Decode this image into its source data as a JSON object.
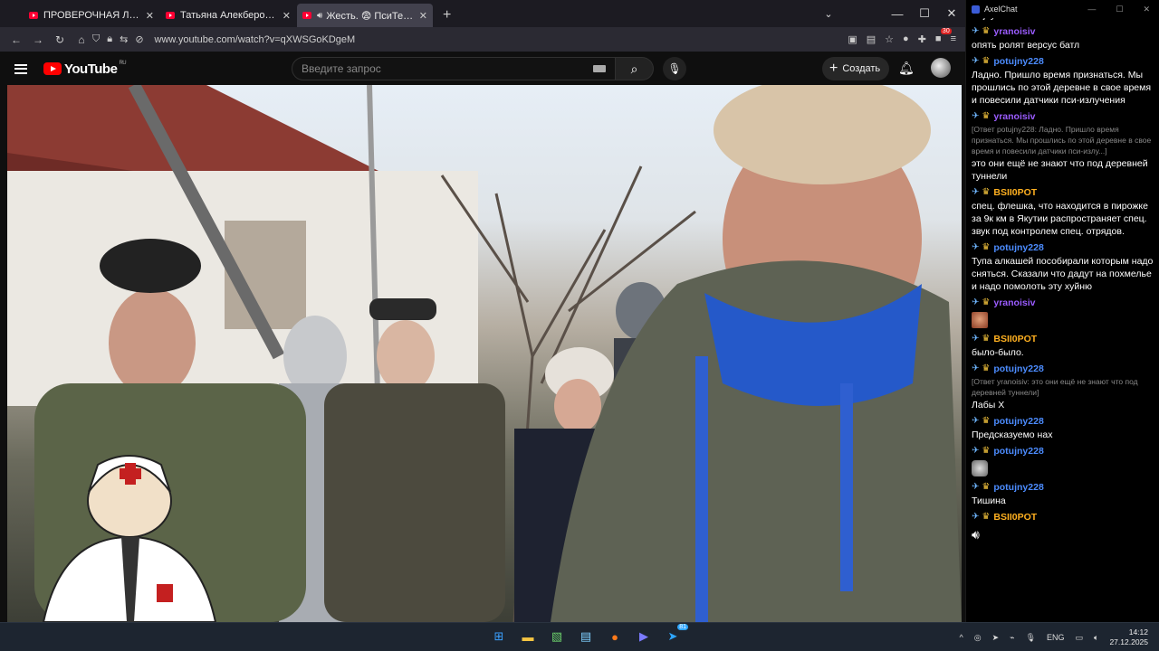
{
  "browser": {
    "tabs": [
      {
        "title": "ПРОВЕРОЧНАЯ ЛИНЕЙКА - М",
        "active": false,
        "audio": false
      },
      {
        "title": "Татьяна Алекберова - YouTube",
        "active": false,
        "audio": false
      },
      {
        "title": "Жесть. 😨 ПсиТеррор Сел",
        "active": true,
        "audio": true
      }
    ],
    "url": "www.youtube.com/watch?v=qXWSGoKDgeM",
    "extension_badge": "30"
  },
  "youtube": {
    "logo": "YouTube",
    "region": "RU",
    "search_placeholder": "Введите запрос",
    "create_label": "Создать"
  },
  "chat": {
    "app_title": "AxelChat",
    "top_partial": "Enjoyer",
    "messages": [
      {
        "user": "yranoisiv",
        "color": "#9b5cff",
        "text": "опять ролят версус батл"
      },
      {
        "user": "potujny228",
        "color": "#4c8cff",
        "text": "Ладно. Пришло время признаться. Мы прошлись по этой деревне в свое время и повесили датчики пси-излучения"
      },
      {
        "user": "yranoisiv",
        "color": "#9b5cff",
        "quote": "[Ответ potujny228: Ладно. Пришло время признаться. Мы прошлись по этой деревне в свое время и повесили датчики пси-излу...]",
        "text": "это они ещё не знают что под деревней туннели"
      },
      {
        "user": "BSII0POT",
        "color": "#ffb020",
        "text": "спец. флешка, что находится в пирожке за 9к км в Якутии распространяет спец. звук под контролем спец. отрядов."
      },
      {
        "user": "potujny228",
        "color": "#4c8cff",
        "text": "Тупа алкашей пособирали которым надо сняться. Сказали что дадут на похмелье и надо помолоть эту хуйню"
      },
      {
        "user": "yranoisiv",
        "color": "#9b5cff",
        "emote": "face"
      },
      {
        "user": "BSII0POT",
        "color": "#ffb020",
        "text": "было-было."
      },
      {
        "user": "potujny228",
        "color": "#4c8cff",
        "quote": "[Ответ yranoisiv: это они ещё не знают что под деревней туннели]",
        "text": "Лабы Х"
      },
      {
        "user": "potujny228",
        "color": "#4c8cff",
        "text": "Предсказуемо нах"
      },
      {
        "user": "potujny228",
        "color": "#4c8cff",
        "emote": "cat"
      },
      {
        "user": "potujny228",
        "color": "#4c8cff",
        "text": "Тишина"
      },
      {
        "user": "BSII0POT",
        "color": "#ffb020",
        "emote": "speaker"
      }
    ]
  },
  "taskbar": {
    "language": "ENG",
    "time": "14:12",
    "date": "27.12.2025",
    "telegram_badge": "81"
  }
}
